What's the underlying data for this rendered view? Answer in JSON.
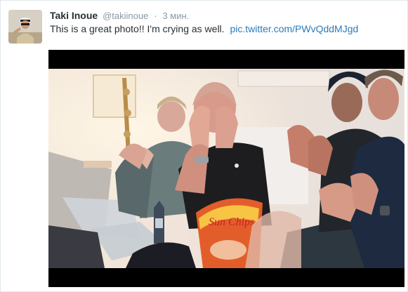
{
  "tweet": {
    "fullname": "Taki Inoue",
    "username": "@takiinoue",
    "separator": "·",
    "timestamp": "3 мин.",
    "text": "This is a great photo!! I'm crying as well.",
    "link": "pic.twitter.com/PWvQddMJgd",
    "snack_bag_text": "Sun Chips"
  },
  "colors": {
    "link": "#2b7bb9",
    "name": "#292f33",
    "muted": "#8899a6"
  }
}
